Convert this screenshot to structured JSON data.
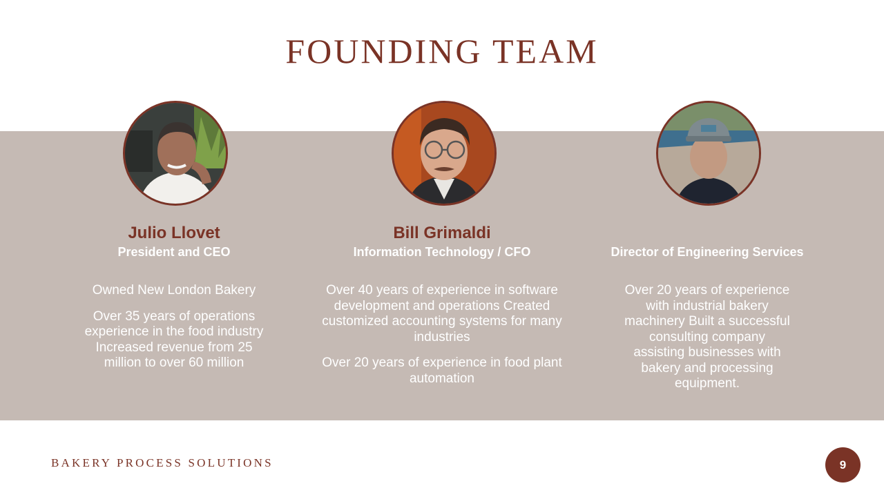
{
  "slide": {
    "title": "FOUNDING TEAM",
    "footer_brand": "BAKERY PROCESS SOLUTIONS",
    "page_number": "9"
  },
  "team": [
    {
      "name": "Julio Llovet",
      "role": "President and CEO",
      "bio": [
        "Owned New London Bakery",
        "Over 35 years of operations experience in the food industry Increased revenue from 25 million to over 60 million"
      ]
    },
    {
      "name": "Bill Grimaldi",
      "role": "Information Technology / CFO",
      "bio": [
        "Over 40 years of experience in software development and operations Created customized accounting systems for many industries",
        "Over 20 years of experience in food plant automation"
      ]
    },
    {
      "name": "",
      "role": "Director of Engineering Services",
      "bio": [
        "Over 20 years of experience with industrial bakery machinery Built a successful consulting company assisting businesses with bakery and processing equipment."
      ]
    }
  ],
  "colors": {
    "accent": "#7a3326",
    "band": "#c5bab4",
    "background": "#ffffff"
  }
}
